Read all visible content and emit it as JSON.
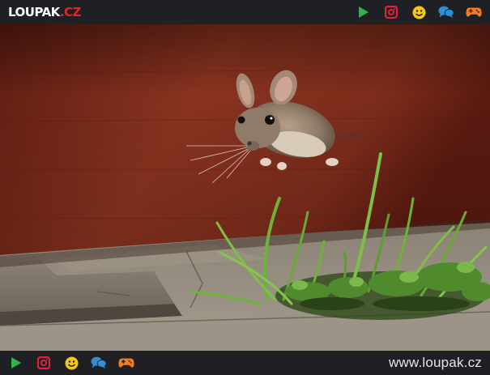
{
  "header": {
    "logo_main": "LOUPAK",
    "logo_tld": ".CZ",
    "icons": [
      "play-icon",
      "instagram-icon",
      "smiley-icon",
      "chat-icon",
      "gamepad-icon"
    ]
  },
  "footer": {
    "icons": [
      "play-icon",
      "instagram-icon",
      "smiley-icon",
      "chat-icon",
      "gamepad-icon"
    ],
    "url": "www.loupak.cz"
  },
  "colors": {
    "bar": "#1e2023",
    "play": "#2fb24a",
    "instagram": "#e2213a",
    "smiley": "#f5c518",
    "chat": "#2f8fd8",
    "gamepad": "#f07d22"
  }
}
